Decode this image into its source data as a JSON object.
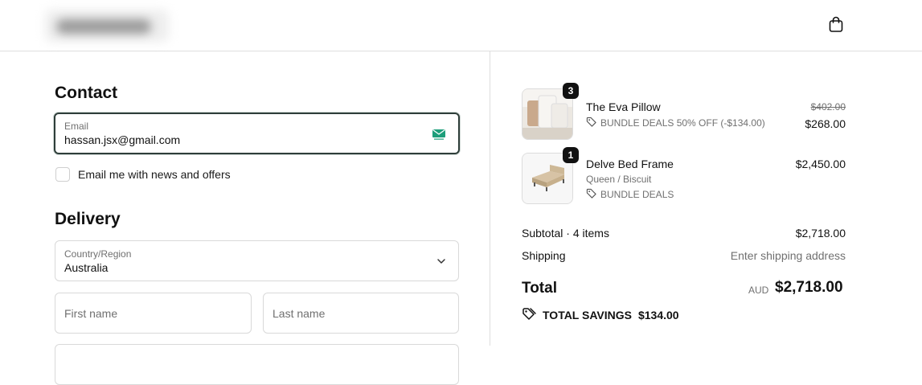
{
  "header": {
    "cart_icon": "shopping-bag-icon"
  },
  "contact": {
    "heading": "Contact",
    "email_label": "Email",
    "email_value": "hassan.jsx@gmail.com",
    "email_icon": "mail-icon",
    "newsletter_label": "Email me with news and offers"
  },
  "delivery": {
    "heading": "Delivery",
    "country_label": "Country/Region",
    "country_value": "Australia",
    "first_name_placeholder": "First name",
    "last_name_placeholder": "Last name"
  },
  "order": {
    "items": [
      {
        "quantity": "3",
        "name": "The Eva Pillow",
        "discount": "BUNDLE DEALS 50% OFF (-$134.00)",
        "original_price": "$402.00",
        "price": "$268.00"
      },
      {
        "quantity": "1",
        "name": "Delve Bed Frame",
        "variant": "Queen / Biscuit",
        "discount": "BUNDLE DEALS",
        "price": "$2,450.00"
      }
    ],
    "subtotal_label": "Subtotal · 4 items",
    "subtotal_value": "$2,718.00",
    "shipping_label": "Shipping",
    "shipping_value": "Enter shipping address",
    "total_label": "Total",
    "currency": "AUD",
    "total_value": "$2,718.00",
    "savings_label": "TOTAL SAVINGS",
    "savings_value": "$134.00"
  },
  "colors": {
    "focus_border": "#2f3e3a",
    "mail_icon": "#1c9e7a"
  }
}
